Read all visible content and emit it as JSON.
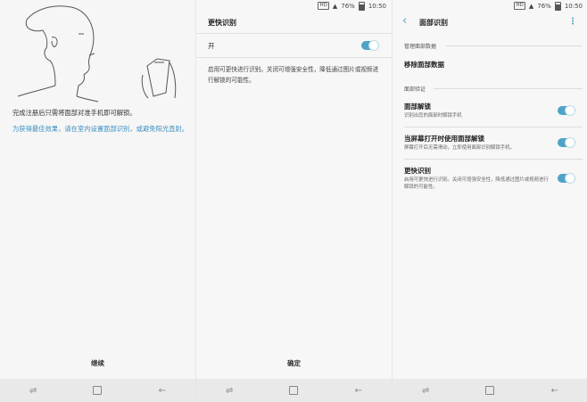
{
  "status": {
    "hd": "HD",
    "battery": "76%",
    "time": "10:50"
  },
  "panel1": {
    "main_text": "完成注册后只需将面部对准手机即可解锁。",
    "hint_text": "为获得最佳效果，请在室内设置面部识别，或避免阳光直射。",
    "continue_label": "继续"
  },
  "panel2": {
    "title": "更快识别",
    "on_label": "开",
    "description": "启用可更快进行识别。关闭可增强安全性，降低通过图片或视频进行解锁的可能性。",
    "confirm_label": "确定"
  },
  "panel3": {
    "title": "面部识别",
    "section_manage": "管理面部数据",
    "remove_label": "移除面部数据",
    "section_verify": "面部验证",
    "unlock_title": "面部解锁",
    "unlock_sub": "识别出您的面部时解锁手机",
    "screen_on_title": "当屏幕打开时使用面部解锁",
    "screen_on_sub": "屏幕打开后无需滑动，立即使用面部识别解锁手机。",
    "faster_title": "更快识别",
    "faster_sub": "启用可更快进行识别。关闭可增强安全性，降低通过图片或视频进行解锁的可能性。"
  },
  "colors": {
    "accent": "#4fa3c8",
    "hint": "#3a8fc0"
  },
  "icons": [
    "back-icon",
    "more-icon",
    "recents-icon",
    "home-icon",
    "nav-back-icon"
  ]
}
